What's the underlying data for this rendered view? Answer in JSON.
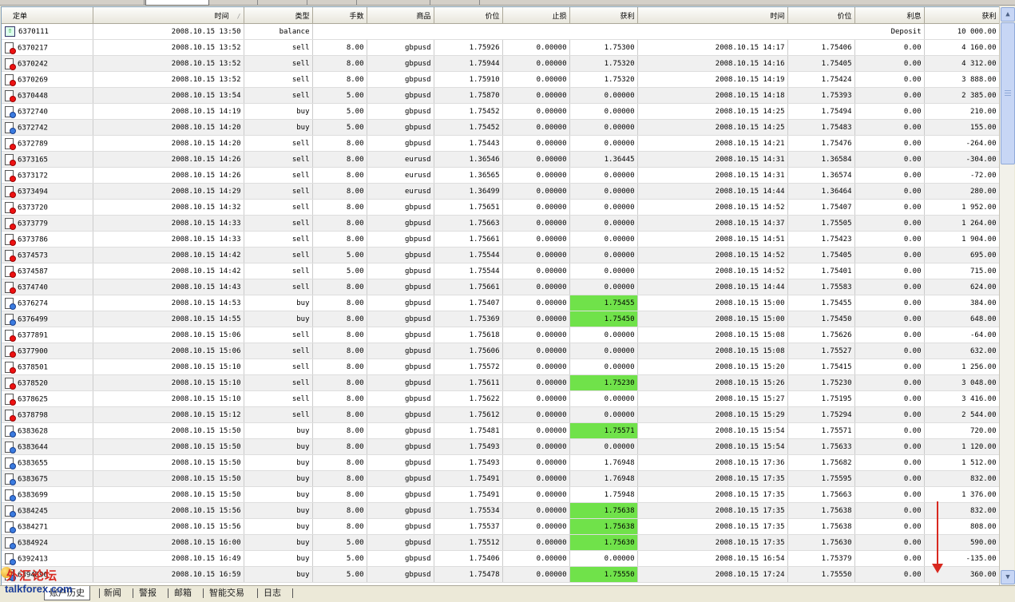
{
  "columns": [
    "定单",
    "时间",
    "类型",
    "手数",
    "商品",
    "价位",
    "止损",
    "获利",
    "时间",
    "价位",
    "利息",
    "获利"
  ],
  "balance_row": {
    "ticket": "6370111",
    "time": "2008.10.15 13:50",
    "type": "balance",
    "comment": "Deposit",
    "profit": "10 000.00"
  },
  "rows": [
    {
      "ticket": "6370217",
      "open_time": "2008.10.15 13:52",
      "type": "sell",
      "lots": "8.00",
      "symbol": "gbpusd",
      "open_price": "1.75926",
      "sl": "0.00000",
      "tp": "1.75300",
      "close_time": "2008.10.15 14:17",
      "close_price": "1.75406",
      "swap": "0.00",
      "profit": "4 160.00",
      "tp_hl": false
    },
    {
      "ticket": "6370242",
      "open_time": "2008.10.15 13:52",
      "type": "sell",
      "lots": "8.00",
      "symbol": "gbpusd",
      "open_price": "1.75944",
      "sl": "0.00000",
      "tp": "1.75320",
      "close_time": "2008.10.15 14:16",
      "close_price": "1.75405",
      "swap": "0.00",
      "profit": "4 312.00",
      "tp_hl": false
    },
    {
      "ticket": "6370269",
      "open_time": "2008.10.15 13:52",
      "type": "sell",
      "lots": "8.00",
      "symbol": "gbpusd",
      "open_price": "1.75910",
      "sl": "0.00000",
      "tp": "1.75320",
      "close_time": "2008.10.15 14:19",
      "close_price": "1.75424",
      "swap": "0.00",
      "profit": "3 888.00",
      "tp_hl": false
    },
    {
      "ticket": "6370448",
      "open_time": "2008.10.15 13:54",
      "type": "sell",
      "lots": "5.00",
      "symbol": "gbpusd",
      "open_price": "1.75870",
      "sl": "0.00000",
      "tp": "0.00000",
      "close_time": "2008.10.15 14:18",
      "close_price": "1.75393",
      "swap": "0.00",
      "profit": "2 385.00",
      "tp_hl": false
    },
    {
      "ticket": "6372740",
      "open_time": "2008.10.15 14:19",
      "type": "buy",
      "lots": "5.00",
      "symbol": "gbpusd",
      "open_price": "1.75452",
      "sl": "0.00000",
      "tp": "0.00000",
      "close_time": "2008.10.15 14:25",
      "close_price": "1.75494",
      "swap": "0.00",
      "profit": "210.00",
      "tp_hl": false
    },
    {
      "ticket": "6372742",
      "open_time": "2008.10.15 14:20",
      "type": "buy",
      "lots": "5.00",
      "symbol": "gbpusd",
      "open_price": "1.75452",
      "sl": "0.00000",
      "tp": "0.00000",
      "close_time": "2008.10.15 14:25",
      "close_price": "1.75483",
      "swap": "0.00",
      "profit": "155.00",
      "tp_hl": false
    },
    {
      "ticket": "6372789",
      "open_time": "2008.10.15 14:20",
      "type": "sell",
      "lots": "8.00",
      "symbol": "gbpusd",
      "open_price": "1.75443",
      "sl": "0.00000",
      "tp": "0.00000",
      "close_time": "2008.10.15 14:21",
      "close_price": "1.75476",
      "swap": "0.00",
      "profit": "-264.00",
      "tp_hl": false
    },
    {
      "ticket": "6373165",
      "open_time": "2008.10.15 14:26",
      "type": "sell",
      "lots": "8.00",
      "symbol": "eurusd",
      "open_price": "1.36546",
      "sl": "0.00000",
      "tp": "1.36445",
      "close_time": "2008.10.15 14:31",
      "close_price": "1.36584",
      "swap": "0.00",
      "profit": "-304.00",
      "tp_hl": false
    },
    {
      "ticket": "6373172",
      "open_time": "2008.10.15 14:26",
      "type": "sell",
      "lots": "8.00",
      "symbol": "eurusd",
      "open_price": "1.36565",
      "sl": "0.00000",
      "tp": "0.00000",
      "close_time": "2008.10.15 14:31",
      "close_price": "1.36574",
      "swap": "0.00",
      "profit": "-72.00",
      "tp_hl": false
    },
    {
      "ticket": "6373494",
      "open_time": "2008.10.15 14:29",
      "type": "sell",
      "lots": "8.00",
      "symbol": "eurusd",
      "open_price": "1.36499",
      "sl": "0.00000",
      "tp": "0.00000",
      "close_time": "2008.10.15 14:44",
      "close_price": "1.36464",
      "swap": "0.00",
      "profit": "280.00",
      "tp_hl": false
    },
    {
      "ticket": "6373720",
      "open_time": "2008.10.15 14:32",
      "type": "sell",
      "lots": "8.00",
      "symbol": "gbpusd",
      "open_price": "1.75651",
      "sl": "0.00000",
      "tp": "0.00000",
      "close_time": "2008.10.15 14:52",
      "close_price": "1.75407",
      "swap": "0.00",
      "profit": "1 952.00",
      "tp_hl": false
    },
    {
      "ticket": "6373779",
      "open_time": "2008.10.15 14:33",
      "type": "sell",
      "lots": "8.00",
      "symbol": "gbpusd",
      "open_price": "1.75663",
      "sl": "0.00000",
      "tp": "0.00000",
      "close_time": "2008.10.15 14:37",
      "close_price": "1.75505",
      "swap": "0.00",
      "profit": "1 264.00",
      "tp_hl": false
    },
    {
      "ticket": "6373786",
      "open_time": "2008.10.15 14:33",
      "type": "sell",
      "lots": "8.00",
      "symbol": "gbpusd",
      "open_price": "1.75661",
      "sl": "0.00000",
      "tp": "0.00000",
      "close_time": "2008.10.15 14:51",
      "close_price": "1.75423",
      "swap": "0.00",
      "profit": "1 904.00",
      "tp_hl": false
    },
    {
      "ticket": "6374573",
      "open_time": "2008.10.15 14:42",
      "type": "sell",
      "lots": "5.00",
      "symbol": "gbpusd",
      "open_price": "1.75544",
      "sl": "0.00000",
      "tp": "0.00000",
      "close_time": "2008.10.15 14:52",
      "close_price": "1.75405",
      "swap": "0.00",
      "profit": "695.00",
      "tp_hl": false
    },
    {
      "ticket": "6374587",
      "open_time": "2008.10.15 14:42",
      "type": "sell",
      "lots": "5.00",
      "symbol": "gbpusd",
      "open_price": "1.75544",
      "sl": "0.00000",
      "tp": "0.00000",
      "close_time": "2008.10.15 14:52",
      "close_price": "1.75401",
      "swap": "0.00",
      "profit": "715.00",
      "tp_hl": false
    },
    {
      "ticket": "6374740",
      "open_time": "2008.10.15 14:43",
      "type": "sell",
      "lots": "8.00",
      "symbol": "gbpusd",
      "open_price": "1.75661",
      "sl": "0.00000",
      "tp": "0.00000",
      "close_time": "2008.10.15 14:44",
      "close_price": "1.75583",
      "swap": "0.00",
      "profit": "624.00",
      "tp_hl": false
    },
    {
      "ticket": "6376274",
      "open_time": "2008.10.15 14:53",
      "type": "buy",
      "lots": "8.00",
      "symbol": "gbpusd",
      "open_price": "1.75407",
      "sl": "0.00000",
      "tp": "1.75455",
      "close_time": "2008.10.15 15:00",
      "close_price": "1.75455",
      "swap": "0.00",
      "profit": "384.00",
      "tp_hl": true
    },
    {
      "ticket": "6376499",
      "open_time": "2008.10.15 14:55",
      "type": "buy",
      "lots": "8.00",
      "symbol": "gbpusd",
      "open_price": "1.75369",
      "sl": "0.00000",
      "tp": "1.75450",
      "close_time": "2008.10.15 15:00",
      "close_price": "1.75450",
      "swap": "0.00",
      "profit": "648.00",
      "tp_hl": true
    },
    {
      "ticket": "6377891",
      "open_time": "2008.10.15 15:06",
      "type": "sell",
      "lots": "8.00",
      "symbol": "gbpusd",
      "open_price": "1.75618",
      "sl": "0.00000",
      "tp": "0.00000",
      "close_time": "2008.10.15 15:08",
      "close_price": "1.75626",
      "swap": "0.00",
      "profit": "-64.00",
      "tp_hl": false
    },
    {
      "ticket": "6377900",
      "open_time": "2008.10.15 15:06",
      "type": "sell",
      "lots": "8.00",
      "symbol": "gbpusd",
      "open_price": "1.75606",
      "sl": "0.00000",
      "tp": "0.00000",
      "close_time": "2008.10.15 15:08",
      "close_price": "1.75527",
      "swap": "0.00",
      "profit": "632.00",
      "tp_hl": false
    },
    {
      "ticket": "6378501",
      "open_time": "2008.10.15 15:10",
      "type": "sell",
      "lots": "8.00",
      "symbol": "gbpusd",
      "open_price": "1.75572",
      "sl": "0.00000",
      "tp": "0.00000",
      "close_time": "2008.10.15 15:20",
      "close_price": "1.75415",
      "swap": "0.00",
      "profit": "1 256.00",
      "tp_hl": false
    },
    {
      "ticket": "6378520",
      "open_time": "2008.10.15 15:10",
      "type": "sell",
      "lots": "8.00",
      "symbol": "gbpusd",
      "open_price": "1.75611",
      "sl": "0.00000",
      "tp": "1.75230",
      "close_time": "2008.10.15 15:26",
      "close_price": "1.75230",
      "swap": "0.00",
      "profit": "3 048.00",
      "tp_hl": true
    },
    {
      "ticket": "6378625",
      "open_time": "2008.10.15 15:10",
      "type": "sell",
      "lots": "8.00",
      "symbol": "gbpusd",
      "open_price": "1.75622",
      "sl": "0.00000",
      "tp": "0.00000",
      "close_time": "2008.10.15 15:27",
      "close_price": "1.75195",
      "swap": "0.00",
      "profit": "3 416.00",
      "tp_hl": false
    },
    {
      "ticket": "6378798",
      "open_time": "2008.10.15 15:12",
      "type": "sell",
      "lots": "8.00",
      "symbol": "gbpusd",
      "open_price": "1.75612",
      "sl": "0.00000",
      "tp": "0.00000",
      "close_time": "2008.10.15 15:29",
      "close_price": "1.75294",
      "swap": "0.00",
      "profit": "2 544.00",
      "tp_hl": false
    },
    {
      "ticket": "6383628",
      "open_time": "2008.10.15 15:50",
      "type": "buy",
      "lots": "8.00",
      "symbol": "gbpusd",
      "open_price": "1.75481",
      "sl": "0.00000",
      "tp": "1.75571",
      "close_time": "2008.10.15 15:54",
      "close_price": "1.75571",
      "swap": "0.00",
      "profit": "720.00",
      "tp_hl": true
    },
    {
      "ticket": "6383644",
      "open_time": "2008.10.15 15:50",
      "type": "buy",
      "lots": "8.00",
      "symbol": "gbpusd",
      "open_price": "1.75493",
      "sl": "0.00000",
      "tp": "0.00000",
      "close_time": "2008.10.15 15:54",
      "close_price": "1.75633",
      "swap": "0.00",
      "profit": "1 120.00",
      "tp_hl": false
    },
    {
      "ticket": "6383655",
      "open_time": "2008.10.15 15:50",
      "type": "buy",
      "lots": "8.00",
      "symbol": "gbpusd",
      "open_price": "1.75493",
      "sl": "0.00000",
      "tp": "1.76948",
      "close_time": "2008.10.15 17:36",
      "close_price": "1.75682",
      "swap": "0.00",
      "profit": "1 512.00",
      "tp_hl": false
    },
    {
      "ticket": "6383675",
      "open_time": "2008.10.15 15:50",
      "type": "buy",
      "lots": "8.00",
      "symbol": "gbpusd",
      "open_price": "1.75491",
      "sl": "0.00000",
      "tp": "1.76948",
      "close_time": "2008.10.15 17:35",
      "close_price": "1.75595",
      "swap": "0.00",
      "profit": "832.00",
      "tp_hl": false
    },
    {
      "ticket": "6383699",
      "open_time": "2008.10.15 15:50",
      "type": "buy",
      "lots": "8.00",
      "symbol": "gbpusd",
      "open_price": "1.75491",
      "sl": "0.00000",
      "tp": "1.75948",
      "close_time": "2008.10.15 17:35",
      "close_price": "1.75663",
      "swap": "0.00",
      "profit": "1 376.00",
      "tp_hl": false
    },
    {
      "ticket": "6384245",
      "open_time": "2008.10.15 15:56",
      "type": "buy",
      "lots": "8.00",
      "symbol": "gbpusd",
      "open_price": "1.75534",
      "sl": "0.00000",
      "tp": "1.75638",
      "close_time": "2008.10.15 17:35",
      "close_price": "1.75638",
      "swap": "0.00",
      "profit": "832.00",
      "tp_hl": true
    },
    {
      "ticket": "6384271",
      "open_time": "2008.10.15 15:56",
      "type": "buy",
      "lots": "8.00",
      "symbol": "gbpusd",
      "open_price": "1.75537",
      "sl": "0.00000",
      "tp": "1.75638",
      "close_time": "2008.10.15 17:35",
      "close_price": "1.75638",
      "swap": "0.00",
      "profit": "808.00",
      "tp_hl": true
    },
    {
      "ticket": "6384924",
      "open_time": "2008.10.15 16:00",
      "type": "buy",
      "lots": "5.00",
      "symbol": "gbpusd",
      "open_price": "1.75512",
      "sl": "0.00000",
      "tp": "1.75630",
      "close_time": "2008.10.15 17:35",
      "close_price": "1.75630",
      "swap": "0.00",
      "profit": "590.00",
      "tp_hl": true
    },
    {
      "ticket": "6392413",
      "open_time": "2008.10.15 16:49",
      "type": "buy",
      "lots": "5.00",
      "symbol": "gbpusd",
      "open_price": "1.75406",
      "sl": "0.00000",
      "tp": "0.00000",
      "close_time": "2008.10.15 16:54",
      "close_price": "1.75379",
      "swap": "0.00",
      "profit": "-135.00",
      "tp_hl": false
    },
    {
      "ticket": "6394890",
      "open_time": "2008.10.15 16:59",
      "type": "buy",
      "lots": "5.00",
      "symbol": "gbpusd",
      "open_price": "1.75478",
      "sl": "0.00000",
      "tp": "1.75550",
      "close_time": "2008.10.15 17:24",
      "close_price": "1.75550",
      "swap": "0.00",
      "profit": "360.00",
      "tp_hl": true
    }
  ],
  "bottom_tabs": [
    "账户历史",
    "新闻",
    "警报",
    "邮箱",
    "智能交易",
    "日志"
  ],
  "watermark": {
    "cn": "外汇论坛",
    "en": "talkforex.com"
  },
  "colors": {
    "tp_highlight": "#70e24a",
    "sell_icon": "#e11111",
    "buy_icon": "#3a7be0",
    "arrow": "#d8281f"
  },
  "icons": {
    "sell": "sell-order-icon",
    "buy": "buy-order-icon",
    "balance": "balance-icon"
  }
}
